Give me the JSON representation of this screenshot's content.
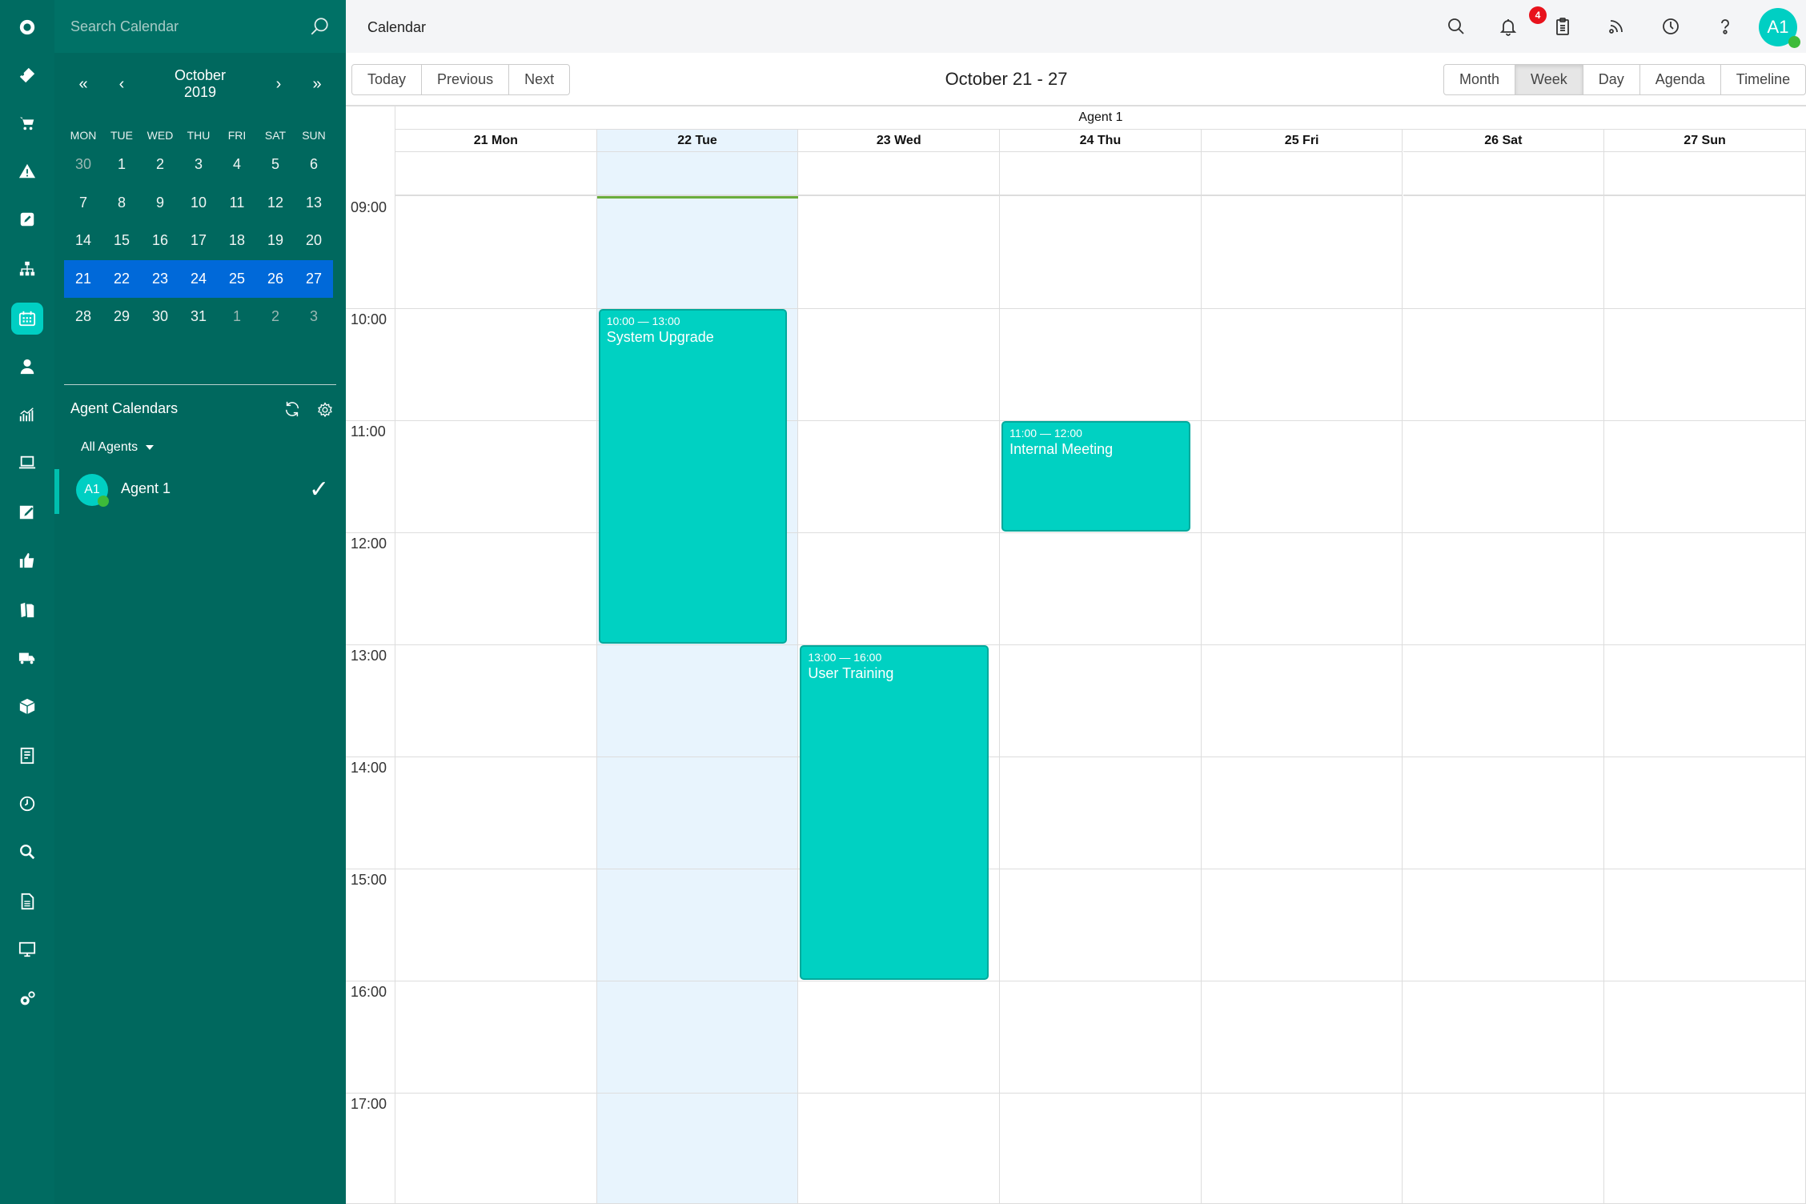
{
  "rail": {
    "items": [
      {
        "name": "logo-icon"
      },
      {
        "name": "ticket-icon"
      },
      {
        "name": "cart-icon"
      },
      {
        "name": "warning-icon"
      },
      {
        "name": "edit-icon"
      },
      {
        "name": "org-chart-icon"
      },
      {
        "name": "calendar-icon",
        "active": true
      },
      {
        "name": "agent-icon"
      },
      {
        "name": "analytics-icon"
      },
      {
        "name": "laptop-icon"
      },
      {
        "name": "notes-icon"
      },
      {
        "name": "thumbs-up-icon"
      },
      {
        "name": "books-icon"
      },
      {
        "name": "truck-icon"
      },
      {
        "name": "package-icon"
      },
      {
        "name": "report-icon"
      },
      {
        "name": "clock-icon"
      },
      {
        "name": "search-icon"
      },
      {
        "name": "document-icon"
      },
      {
        "name": "monitor-icon"
      },
      {
        "name": "settings-icon"
      }
    ]
  },
  "panel": {
    "search_placeholder": "Search Calendar",
    "mini_calendar": {
      "month": "October",
      "year": "2019",
      "nav": {
        "prev_year": "«",
        "prev_month": "‹",
        "next_month": "›",
        "next_year": "»"
      },
      "weekdays": [
        "MON",
        "TUE",
        "WED",
        "THU",
        "FRI",
        "SAT",
        "SUN"
      ],
      "weeks": [
        [
          {
            "d": "30",
            "muted": true
          },
          {
            "d": "1"
          },
          {
            "d": "2"
          },
          {
            "d": "3"
          },
          {
            "d": "4"
          },
          {
            "d": "5"
          },
          {
            "d": "6"
          }
        ],
        [
          {
            "d": "7"
          },
          {
            "d": "8"
          },
          {
            "d": "9"
          },
          {
            "d": "10"
          },
          {
            "d": "11"
          },
          {
            "d": "12"
          },
          {
            "d": "13"
          }
        ],
        [
          {
            "d": "14"
          },
          {
            "d": "15"
          },
          {
            "d": "16"
          },
          {
            "d": "17"
          },
          {
            "d": "18"
          },
          {
            "d": "19"
          },
          {
            "d": "20"
          }
        ],
        [
          {
            "d": "21"
          },
          {
            "d": "22"
          },
          {
            "d": "23"
          },
          {
            "d": "24"
          },
          {
            "d": "25"
          },
          {
            "d": "26"
          },
          {
            "d": "27"
          }
        ],
        [
          {
            "d": "28"
          },
          {
            "d": "29"
          },
          {
            "d": "30"
          },
          {
            "d": "31"
          },
          {
            "d": "1",
            "muted": true
          },
          {
            "d": "2",
            "muted": true
          },
          {
            "d": "3",
            "muted": true
          }
        ]
      ],
      "selected_week_index": 3
    },
    "agent_calendars": {
      "title": "Agent Calendars",
      "filter_label": "All Agents",
      "agents": [
        {
          "initials": "A1",
          "name": "Agent 1",
          "checked": true,
          "status": "online"
        }
      ]
    }
  },
  "topbar": {
    "title": "Calendar",
    "icons": [
      "search-icon",
      "bell-icon",
      "clipboard-icon",
      "rss-icon",
      "clock-icon",
      "help-icon"
    ],
    "clipboard_badge": "4",
    "avatar_initials": "A1"
  },
  "toolbar": {
    "nav_buttons": [
      "Today",
      "Previous",
      "Next"
    ],
    "range_title": "October 21 - 27",
    "view_buttons": [
      "Month",
      "Week",
      "Day",
      "Agenda",
      "Timeline"
    ],
    "active_view": "Week"
  },
  "week": {
    "resource": "Agent 1",
    "days": [
      "21 Mon",
      "22 Tue",
      "23 Wed",
      "24 Thu",
      "25 Fri",
      "26 Sat",
      "27 Sun"
    ],
    "today_index": 1,
    "hours": [
      "09:00",
      "10:00",
      "11:00",
      "12:00",
      "13:00",
      "14:00",
      "15:00",
      "16:00",
      "17:00"
    ],
    "now_time": "09:00",
    "events": [
      {
        "day": 1,
        "start": "10:00",
        "end": "13:00",
        "time_label": "10:00 — 13:00",
        "title": "System Upgrade"
      },
      {
        "day": 3,
        "start": "11:00",
        "end": "12:00",
        "time_label": "11:00 — 12:00",
        "title": "Internal Meeting"
      },
      {
        "day": 2,
        "start": "13:00",
        "end": "16:00",
        "time_label": "13:00 — 16:00",
        "title": "User Training"
      }
    ]
  },
  "colors": {
    "rail_bg": "#006b61",
    "panel_bg": "#00685e",
    "accent": "#00cfc3",
    "selected_week": "#0069d9",
    "event_bg": "#00d1c2",
    "today_column": "#e8f4fd",
    "now_line": "#6aad3c",
    "badge": "#e8121c"
  }
}
